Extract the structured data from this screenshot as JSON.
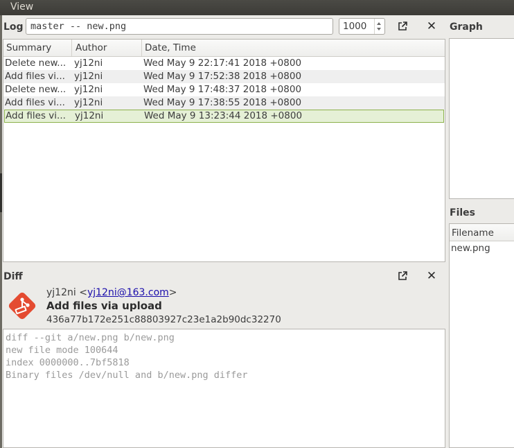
{
  "menubar": {
    "view": "View"
  },
  "log": {
    "label": "Log",
    "filter_value": "master -- new.png",
    "limit_value": "1000",
    "columns": [
      "Summary",
      "Author",
      "Date, Time"
    ],
    "rows": [
      {
        "summary": "Delete new...",
        "author": "yj12ni",
        "date": "Wed May 9 22:17:41 2018 +0800"
      },
      {
        "summary": "Add files vi...",
        "author": "yj12ni",
        "date": "Wed May 9 17:52:38 2018 +0800"
      },
      {
        "summary": "Delete new...",
        "author": "yj12ni",
        "date": "Wed May 9 17:48:37 2018 +0800"
      },
      {
        "summary": "Add files vi...",
        "author": "yj12ni",
        "date": "Wed May 9 17:38:55 2018 +0800"
      },
      {
        "summary": "Add files vi...",
        "author": "yj12ni",
        "date": "Wed May 9 13:23:44 2018 +0800"
      }
    ],
    "selected_row": 4
  },
  "diff": {
    "label": "Diff",
    "author_name": "yj12ni",
    "author_email": "yj12ni@163.com",
    "commit_message": "Add files via upload",
    "commit_hash": "436a77b172e251c88803927c23e1a2b90dc32270",
    "lines": [
      "diff --git a/new.png b/new.png",
      "new file mode 100644",
      "index 0000000..7bf5818",
      "Binary files /dev/null and b/new.png differ"
    ]
  },
  "graph": {
    "label": "Graph"
  },
  "files": {
    "label": "Files",
    "column": "Filename",
    "items": [
      "new.png"
    ]
  },
  "icons": {
    "popout": "external-window-icon",
    "close": "close-icon",
    "logo": "git-logo-icon"
  },
  "colors": {
    "selection_bg": "#e5f0d6",
    "selection_border": "#8cb14b",
    "logo": "#e44b31",
    "link": "#1a0dab"
  }
}
